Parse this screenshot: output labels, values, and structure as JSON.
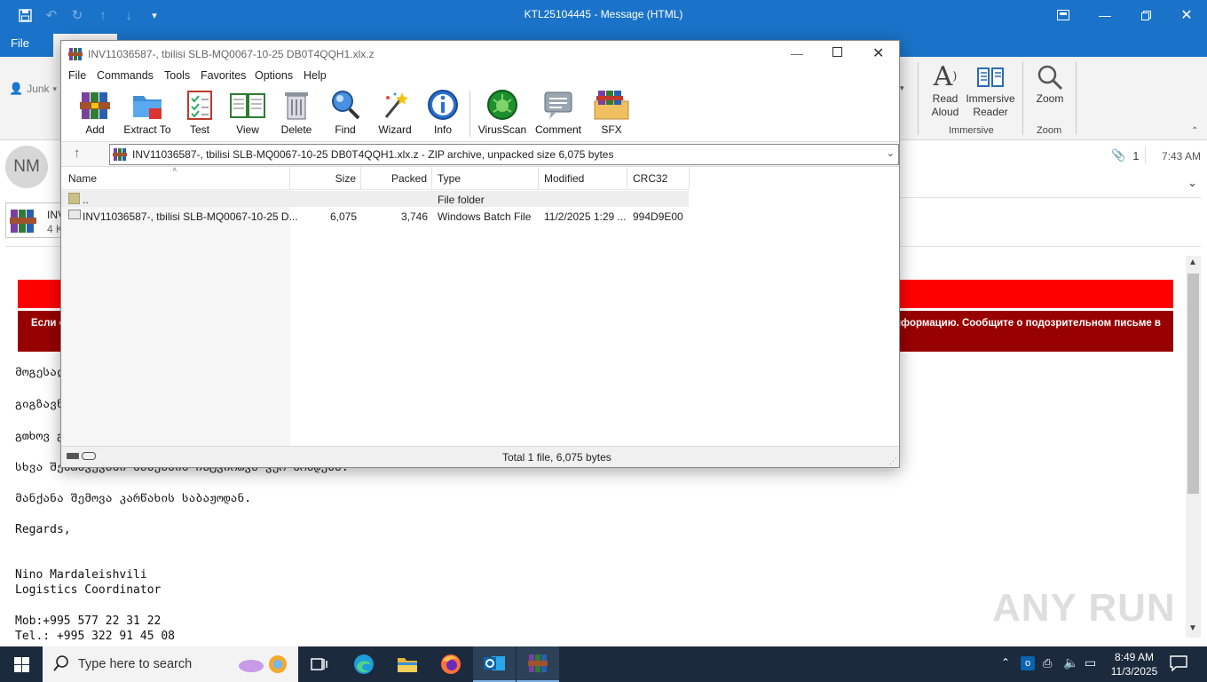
{
  "outlook": {
    "title": "KTL25104445  -  Message (HTML)",
    "tab_file": "File",
    "junk_label": "Junk",
    "ribbon": {
      "read_aloud": [
        "Read",
        "Aloud"
      ],
      "immersive_reader": [
        "Immersive",
        "Reader"
      ],
      "immersive_group": "Immersive",
      "zoom": "Zoom",
      "zoom_group": "Zoom"
    },
    "avatar_initials": "NM",
    "attachment_count": "1",
    "time": "7:43 AM",
    "attachment": {
      "name": "INV",
      "size": "4 K"
    },
    "banner_text_left": "Если о",
    "banner_text_right": "ую информацию. Сообщите о подозрительном письме в",
    "body_lines": [
      "მოგესალ",
      "გიგზავნ",
      "გთხოვ გ",
      "სხვა შემთხვევაში მანქანის ჩატვირთვა ვერ მოხდება.",
      "მანქანა შემოვა კარწახის საბაჟოდან.",
      "Regards,"
    ],
    "signature": {
      "name": "Nino Mardaleishvili",
      "role": "Logistics Coordinator",
      "mob": "Mob:+995 577 22 31 22",
      "tel": "Tel.: +995 322 91 45 08"
    },
    "watermark": "ANY RUN"
  },
  "winrar": {
    "title": "INV11036587-, tbilisi SLB-MQ0067-10-25 DB0T4QQH1.xlx.z",
    "menu": [
      "File",
      "Commands",
      "Tools",
      "Favorites",
      "Options",
      "Help"
    ],
    "toolbar": [
      "Add",
      "Extract To",
      "Test",
      "View",
      "Delete",
      "Find",
      "Wizard",
      "Info",
      "VirusScan",
      "Comment",
      "SFX"
    ],
    "address": "INV11036587-, tbilisi SLB-MQ0067-10-25 DB0T4QQH1.xlx.z - ZIP archive, unpacked size 6,075 bytes",
    "columns": [
      "Name",
      "Size",
      "Packed",
      "Type",
      "Modified",
      "CRC32"
    ],
    "rows": [
      {
        "name": "..",
        "size": "",
        "packed": "",
        "type": "File folder",
        "modified": "",
        "crc": ""
      },
      {
        "name": "INV11036587-, tbilisi SLB-MQ0067-10-25 D...",
        "size": "6,075",
        "packed": "3,746",
        "type": "Windows Batch File",
        "modified": "11/2/2025 1:29 ...",
        "crc": "994D9E00"
      }
    ],
    "status": "Total 1 file, 6,075 bytes"
  },
  "taskbar": {
    "search_placeholder": "Type here to search",
    "time": "8:49 AM",
    "date": "11/3/2025"
  },
  "colors": {
    "outlook_blue": "#1a73c8",
    "banner_red": "#ff0000",
    "banner_dark": "#980000",
    "taskbar": "#1b2a3c"
  }
}
